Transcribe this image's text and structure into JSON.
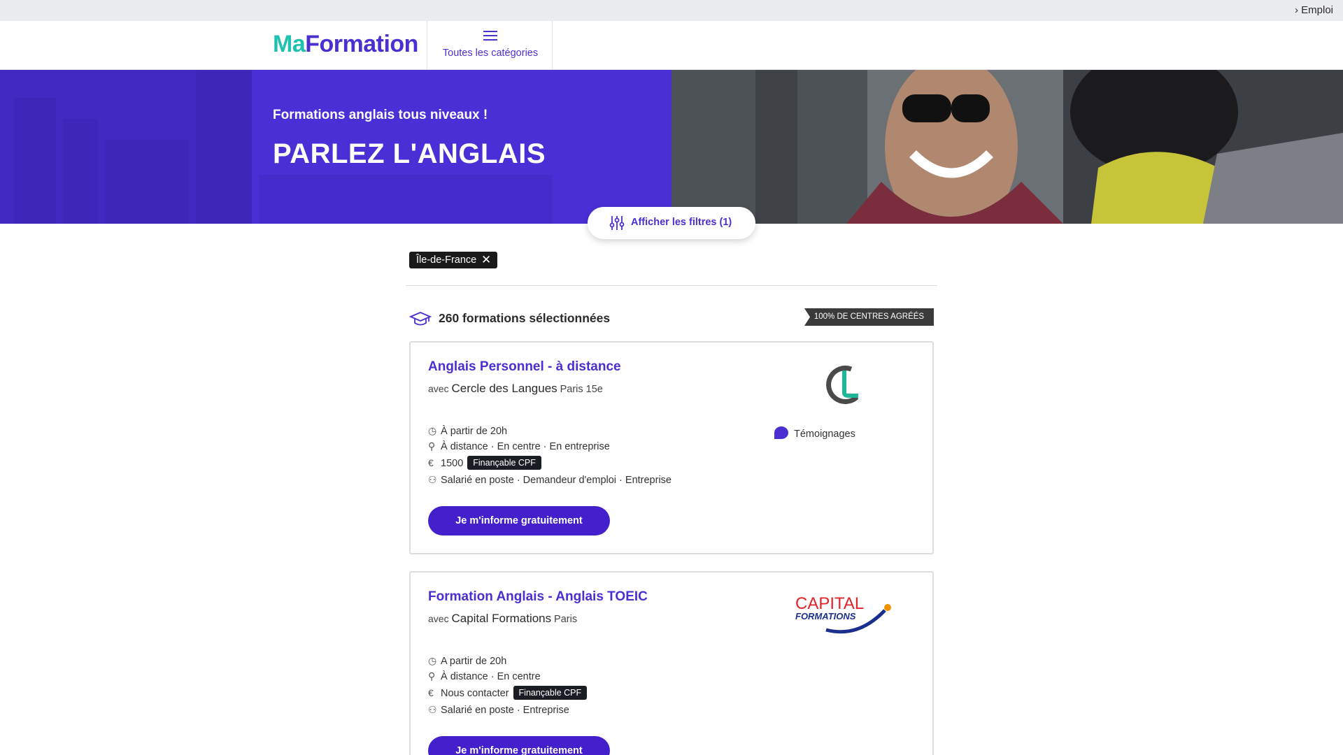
{
  "topbar": {
    "breadcrumb": "› Emploi"
  },
  "header": {
    "logo_ma": "Ma",
    "logo_formation": "Formation",
    "categories_label": "Toutes les catégories"
  },
  "hero": {
    "subtitle": "Formations anglais tous niveaux !",
    "title": "PARLEZ L'ANGLAIS",
    "filters_button": "Afficher les filtres (1)"
  },
  "active_filter": {
    "label": "Île-de-France",
    "remove": "✕"
  },
  "results": {
    "count_text": "260 formations sélectionnées",
    "badge": "100% DE CENTRES AGRÉÉS"
  },
  "cards": [
    {
      "title": "Anglais Personnel - à distance",
      "with_prefix": "avec",
      "organization": "Cercle des Langues",
      "city": "Paris 15e",
      "duration": "À partir de 20h",
      "modes": "À distance · En centre · En entreprise",
      "price": "1500",
      "cpf_label": "Finançable CPF",
      "audience": "Salarié en poste · Demandeur d'emploi · Entreprise",
      "testimonials": "Témoignages",
      "cta": "Je m'informe gratuitement"
    },
    {
      "title": "Formation Anglais - Anglais TOEIC",
      "with_prefix": "avec",
      "organization": "Capital Formations",
      "city": "Paris",
      "duration": "A partir de 20h",
      "modes": "À distance · En centre",
      "price": "Nous contacter",
      "cpf_label": "Finançable CPF",
      "audience": "Salarié en poste · Entreprise",
      "logo_line1": "CAPITAL",
      "logo_line2": "FORMATIONS",
      "cta": "Je m'informe gratuitement"
    }
  ],
  "icons": {
    "duration": "clock-icon",
    "modes": "location-pin-icon",
    "price": "euro-icon",
    "audience": "person-icon",
    "results": "graduation-cap-icon",
    "filters": "sliders-icon",
    "categories": "hamburger-menu-icon",
    "testimonials": "speech-bubble-icon"
  },
  "colors": {
    "brand_purple": "#4b2fd0",
    "brand_teal": "#1fc1b0",
    "cta": "#4420cc",
    "dark_badge": "#1a1d24"
  }
}
